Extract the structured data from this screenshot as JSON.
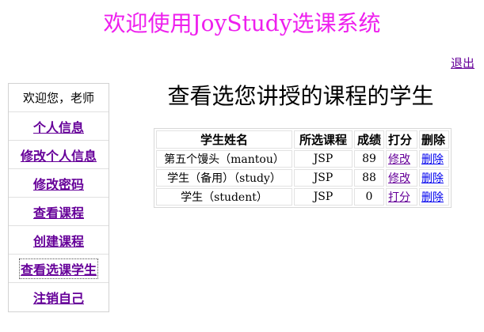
{
  "header": {
    "site_title": "欢迎使用JoyStudy选课系统",
    "logout_label": "退出"
  },
  "sidebar": {
    "welcome": "欢迎您，老师",
    "items": [
      {
        "label": "个人信息",
        "active": false
      },
      {
        "label": "修改个人信息",
        "active": false
      },
      {
        "label": "修改密码",
        "active": false
      },
      {
        "label": "查看课程",
        "active": false
      },
      {
        "label": "创建课程",
        "active": false
      },
      {
        "label": "查看选课学生",
        "active": true
      },
      {
        "label": "注销自己",
        "active": false
      }
    ]
  },
  "main": {
    "title": "查看选您讲授的课程的学生",
    "table": {
      "headers": [
        "学生姓名",
        "所选课程",
        "成绩",
        "打分",
        "删除"
      ],
      "rows": [
        {
          "name": "第五个馒头（mantou）",
          "course": "JSP",
          "score": "89",
          "grade_action": "修改",
          "delete_action": "删除"
        },
        {
          "name": "学生（备用）（study）",
          "course": "JSP",
          "score": "88",
          "grade_action": "修改",
          "delete_action": "删除"
        },
        {
          "name": "学生（student）",
          "course": "JSP",
          "score": "0",
          "grade_action": "打分",
          "delete_action": "删除"
        }
      ]
    }
  },
  "colors": {
    "site_title": "#ee1fee",
    "link_purple": "#660099",
    "link_blue": "#0000ee",
    "text": "#000000",
    "border": "#d2d2d2"
  }
}
